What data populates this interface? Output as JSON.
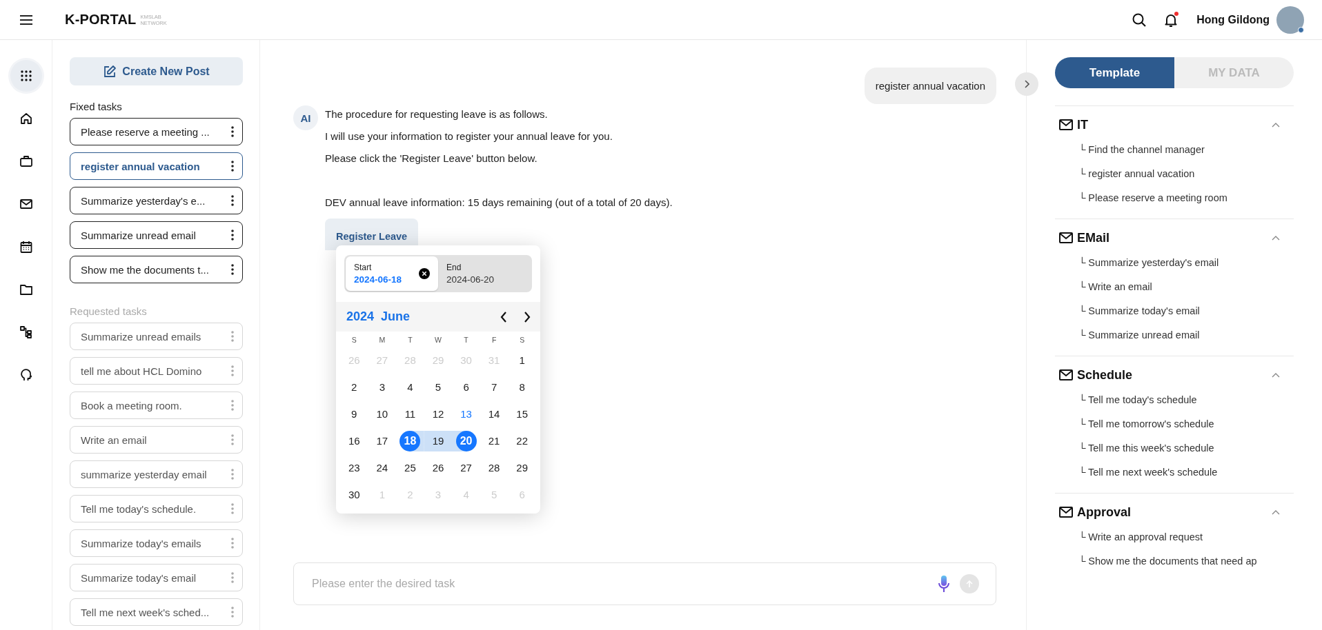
{
  "header": {
    "logo": "K-PORTAL",
    "logo_sub": [
      "KMSLAB",
      "NETWORK"
    ],
    "notification": {
      "unread": true
    },
    "user": {
      "name": "Hong Gildong",
      "online": true
    }
  },
  "rail": {
    "items": [
      {
        "selected": true
      },
      {
        "selected": false
      },
      {
        "selected": false
      },
      {
        "selected": false
      },
      {
        "selected": false
      },
      {
        "selected": false
      },
      {
        "selected": false
      },
      {
        "selected": false
      }
    ]
  },
  "tasks": {
    "create_button": "Create New Post",
    "fixed_title": "Fixed tasks",
    "fixed": [
      {
        "label": "Please reserve a meeting ...",
        "selected": false
      },
      {
        "label": "register annual vacation",
        "selected": true
      },
      {
        "label": "Summarize yesterday's e...",
        "selected": false
      },
      {
        "label": "Summarize unread email",
        "selected": false
      },
      {
        "label": "Show me the documents t...",
        "selected": false
      }
    ],
    "requested_title": "Requested tasks",
    "requested": [
      "Summarize unread emails",
      "tell me about HCL Domino",
      "Book a meeting room.",
      "Write an email",
      "summarize yesterday email",
      "Tell me today's schedule.",
      "Summarize today's emails",
      "Summarize today's email",
      "Tell me next week's sched..."
    ]
  },
  "chat": {
    "user_message": "register annual vacation",
    "ai_badge": "AI",
    "ai_paragraphs": [
      [
        "The procedure for requesting leave is as follows.",
        "I will use your information to register your annual leave for you.",
        "Please click the 'Register Leave' button below."
      ],
      [
        "DEV annual leave information: 15 days remaining (out of a total of 20 days)."
      ]
    ],
    "action_button": "Register Leave",
    "date_picker": {
      "fields": [
        {
          "label": "Start",
          "value": "2024-06-18",
          "selected": true
        },
        {
          "label": "End",
          "value": "2024-06-20",
          "selected": false
        }
      ],
      "year": "2024",
      "month": "June",
      "weekdays": [
        "S",
        "M",
        "T",
        "W",
        "T",
        "F",
        "S"
      ],
      "days": [
        {
          "text": "26",
          "kind": "outside"
        },
        {
          "text": "27",
          "kind": "outside"
        },
        {
          "text": "28",
          "kind": "outside"
        },
        {
          "text": "29",
          "kind": "outside"
        },
        {
          "text": "30",
          "kind": "outside"
        },
        {
          "text": "31",
          "kind": "outside"
        },
        {
          "text": "1",
          "kind": "day"
        },
        {
          "text": "2",
          "kind": "day"
        },
        {
          "text": "3",
          "kind": "day"
        },
        {
          "text": "4",
          "kind": "day"
        },
        {
          "text": "5",
          "kind": "day"
        },
        {
          "text": "6",
          "kind": "day"
        },
        {
          "text": "7",
          "kind": "day"
        },
        {
          "text": "8",
          "kind": "day"
        },
        {
          "text": "9",
          "kind": "day"
        },
        {
          "text": "10",
          "kind": "day"
        },
        {
          "text": "11",
          "kind": "day"
        },
        {
          "text": "12",
          "kind": "day"
        },
        {
          "text": "13",
          "kind": "today"
        },
        {
          "text": "14",
          "kind": "day"
        },
        {
          "text": "15",
          "kind": "day"
        },
        {
          "text": "16",
          "kind": "day"
        },
        {
          "text": "17",
          "kind": "day"
        },
        {
          "text": "18",
          "kind": "start"
        },
        {
          "text": "19",
          "kind": "between"
        },
        {
          "text": "20",
          "kind": "end"
        },
        {
          "text": "21",
          "kind": "day"
        },
        {
          "text": "22",
          "kind": "day"
        },
        {
          "text": "23",
          "kind": "day"
        },
        {
          "text": "24",
          "kind": "day"
        },
        {
          "text": "25",
          "kind": "day"
        },
        {
          "text": "26",
          "kind": "day"
        },
        {
          "text": "27",
          "kind": "day"
        },
        {
          "text": "28",
          "kind": "day"
        },
        {
          "text": "29",
          "kind": "day"
        },
        {
          "text": "30",
          "kind": "day"
        },
        {
          "text": "1",
          "kind": "outside"
        },
        {
          "text": "2",
          "kind": "outside"
        },
        {
          "text": "3",
          "kind": "outside"
        },
        {
          "text": "4",
          "kind": "outside"
        },
        {
          "text": "5",
          "kind": "outside"
        },
        {
          "text": "6",
          "kind": "outside"
        }
      ]
    },
    "input": {
      "placeholder": "Please enter the desired task"
    },
    "send_button": {
      "disabled": true
    }
  },
  "templates": {
    "tabs": [
      {
        "label": "Template",
        "selected": true
      },
      {
        "label": "MY DATA",
        "selected": false
      }
    ],
    "sections": [
      {
        "title": "IT",
        "expanded": true,
        "items": [
          "└ Find the channel manager",
          "└ register annual vacation",
          "└ Please reserve a meeting room"
        ]
      },
      {
        "title": "EMail",
        "expanded": true,
        "items": [
          "└ Summarize yesterday's email",
          "└ Write an email",
          "└ Summarize today's email",
          "└ Summarize unread email"
        ]
      },
      {
        "title": "Schedule",
        "expanded": true,
        "items": [
          "└ Tell me today's schedule",
          "└ Tell me tomorrow's schedule",
          "└ Tell me this week's schedule",
          "└ Tell me next week's schedule"
        ]
      },
      {
        "title": "Approval",
        "expanded": true,
        "items": [
          "└ Write an approval request",
          "└ Show me the documents that need ap"
        ]
      }
    ]
  }
}
